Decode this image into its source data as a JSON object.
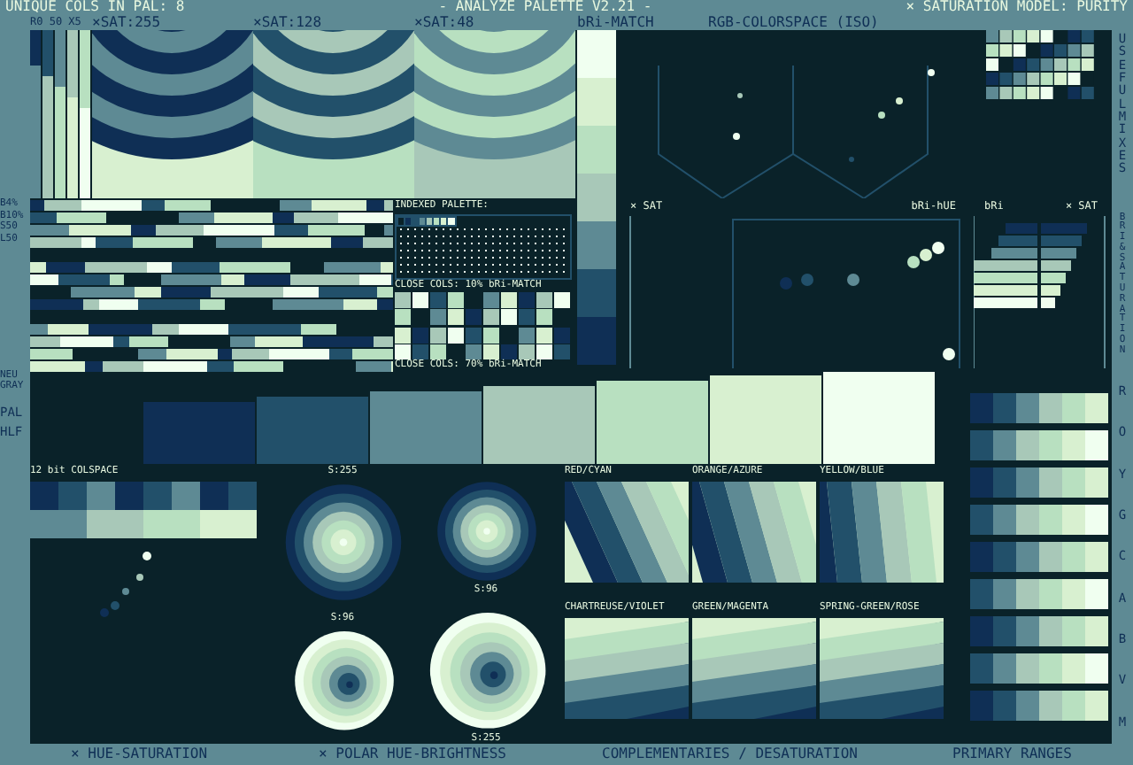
{
  "header": {
    "unique_colors": "UNIQUE COLS IN PAL: 8",
    "title": "- ANALYZE PALETTE V2.21 -",
    "model": "× SATURATION MODEL: PURITY"
  },
  "subheader": {
    "channels": "R0 50 X5",
    "sat_panels": [
      "×SAT:255",
      "×SAT:128",
      "×SAT:48"
    ],
    "bri_match": "bRi-MATCH",
    "colorspace": "RGB-COLORSPACE (ISO)"
  },
  "palette": [
    {
      "color": "#0a2229"
    },
    {
      "color": "#0f2f55"
    },
    {
      "color": "#22506a"
    },
    {
      "color": "#5e8a94"
    },
    {
      "color": "#a8c8b8"
    },
    {
      "color": "#b8e0c0"
    },
    {
      "color": "#d8f0d0"
    },
    {
      "color": "#f0fff0"
    }
  ],
  "row_labels": [
    "B4%",
    "B10%",
    "S50",
    "L50"
  ],
  "gray_label": "NEU GRAY",
  "pal_labels": [
    "PAL",
    "HLF"
  ],
  "indexed_palette": {
    "title": "INDEXED PALETTE:"
  },
  "close_cols": [
    "CLOSE COLS: 10% bRi-MATCH",
    "CLOSE COLS: 70% bRi-MATCH"
  ],
  "scatter": {
    "x_label": "× SAT",
    "y_label": "bRi-hUE"
  },
  "bri_sat": {
    "left": "bRi",
    "right": "× SAT"
  },
  "side_titles": [
    "USEFUL MIXES",
    "BRI & SATURATION"
  ],
  "hue_letters": [
    "R",
    "O",
    "Y",
    "G",
    "C",
    "A",
    "B",
    "V",
    "M"
  ],
  "colspace": {
    "title": "12 bit COLSPACE"
  },
  "polar_labels": [
    "S:255",
    "S:96",
    "S:96",
    "S:255"
  ],
  "complementaries": [
    "RED/CYAN",
    "ORANGE/AZURE",
    "YELLOW/BLUE",
    "CHARTREUSE/VIOLET",
    "GREEN/MAGENTA",
    "SPRING-GREEN/ROSE"
  ],
  "footer": [
    "× HUE-SATURATION",
    "× POLAR HUE-BRIGHTNESS",
    "COMPLEMENTARIES / DESATURATION",
    "PRIMARY RANGES"
  ]
}
